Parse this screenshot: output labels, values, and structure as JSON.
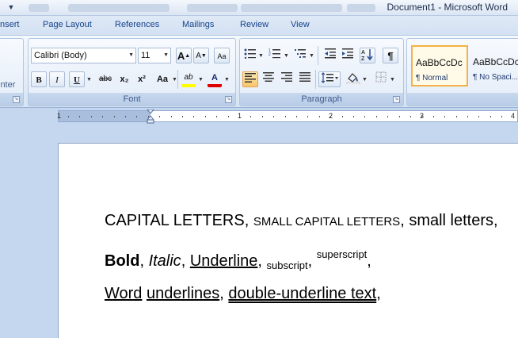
{
  "window": {
    "title": "Document1 - Microsoft Word",
    "qat_icon": "customize-toolbar-arrow"
  },
  "tabs": [
    {
      "label": "nsert"
    },
    {
      "label": "Page Layout"
    },
    {
      "label": "References"
    },
    {
      "label": "Mailings"
    },
    {
      "label": "Review"
    },
    {
      "label": "View"
    }
  ],
  "clipboard": {
    "partial_label": "inter"
  },
  "font_group": {
    "label": "Font",
    "font_name": "Calibri (Body)",
    "font_size": "11",
    "grow_font": "A",
    "shrink_font": "A",
    "clear_format": "Aa",
    "bold": "B",
    "italic": "I",
    "underline": "U",
    "strikethrough": "abc",
    "subscript": "x₂",
    "superscript": "x²",
    "change_case": "Aa",
    "highlight": "ab",
    "font_color": "A",
    "highlight_color": "#ffff00",
    "font_color_value": "#e00000"
  },
  "paragraph_group": {
    "label": "Paragraph",
    "bullets": "bullets-icon",
    "numbering": "numbering-icon",
    "multilevel": "multilevel-list-icon",
    "decrease_indent": "decrease-indent-icon",
    "increase_indent": "increase-indent-icon",
    "sort": "sort-icon",
    "show_marks": "¶",
    "align_left": "align-left-icon",
    "center": "align-center-icon",
    "align_right": "align-right-icon",
    "justify": "justify-icon",
    "line_spacing": "line-spacing-icon",
    "shading": "shading-icon",
    "borders": "borders-icon"
  },
  "styles_group": {
    "styles": [
      {
        "sample": "AaBbCcDc",
        "name": "¶ Normal",
        "selected": true
      },
      {
        "sample": "AaBbCcDc",
        "name": "¶ No Spaci..."
      }
    ]
  },
  "ruler": {
    "numbers": [
      "1",
      "1",
      "2",
      "3",
      "4"
    ]
  },
  "document": {
    "line1": {
      "caps": "CAPITAL LETTERS",
      "sep1": ", ",
      "small_caps": "SMALL CAPITAL LETTERS",
      "sep2": ", ",
      "small": "small letters",
      "sep3": ","
    },
    "line2": {
      "bold": "Bold",
      "sep1": ", ",
      "italic": "Italic",
      "sep2": ", ",
      "underline": "Underline",
      "sep3": ", ",
      "subscript": "subscript",
      "sep4": ", ",
      "superscript": "superscript",
      "sep5": ","
    },
    "line3": {
      "word_ul": "Word",
      "space": " ",
      "word_ul2": "underlines",
      "sep1": ", ",
      "double_ul": "double-underline text",
      "sep2": ","
    }
  }
}
